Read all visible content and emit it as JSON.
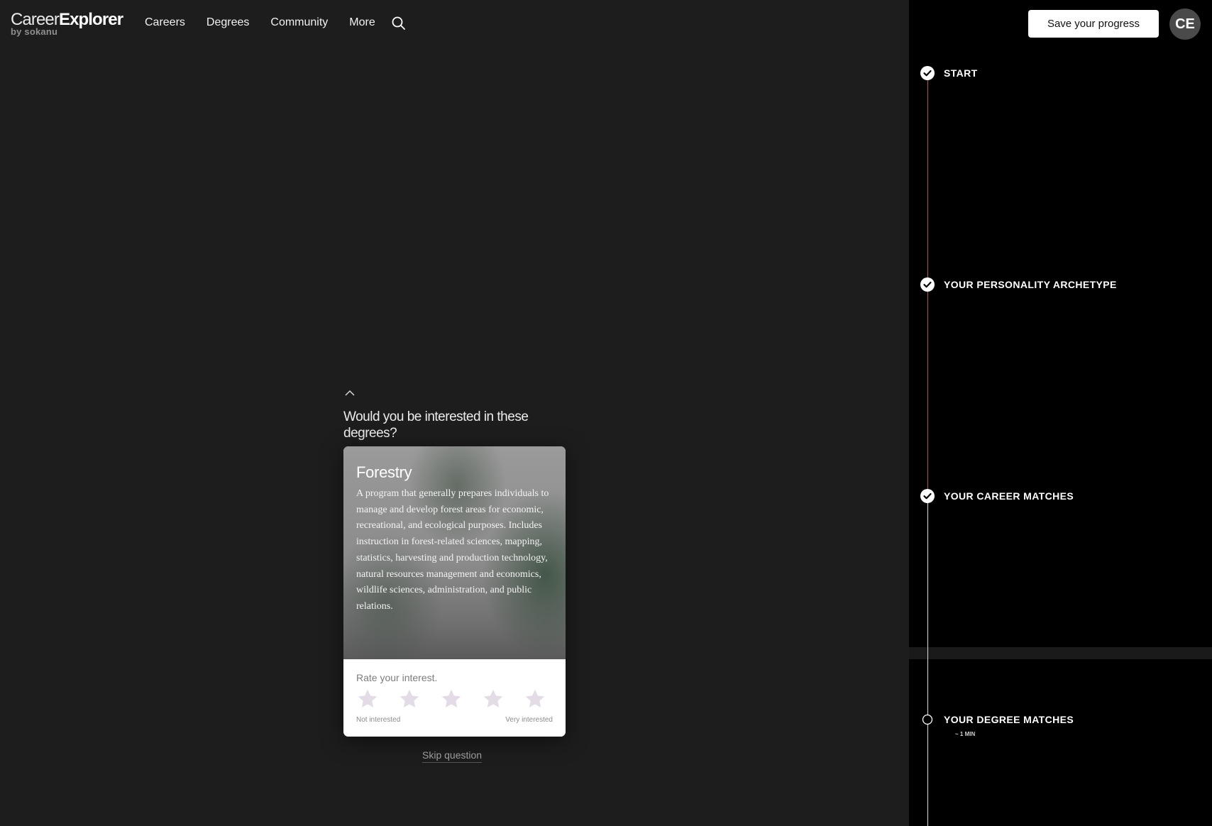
{
  "brand": {
    "name_light": "Career",
    "name_bold": "Explorer",
    "tagline": "by sokanu"
  },
  "nav": {
    "items": [
      {
        "label": "Careers"
      },
      {
        "label": "Degrees"
      },
      {
        "label": "Community"
      },
      {
        "label": "More"
      }
    ],
    "search_icon": "search-icon"
  },
  "question": {
    "text": "Would you be interested in these degrees?",
    "collapse_icon": "chevron-up-icon"
  },
  "card": {
    "title": "Forestry",
    "description": "A program that generally prepares individuals to manage and develop forest areas for economic, recreational, and ecological purposes. Includes instruction in forest-related sciences, mapping, statistics, harvesting and production technology, natural resources management and economics, wildlife sciences, administration, and public relations.",
    "rating_prompt": "Rate your interest.",
    "rating_value": 0,
    "rating_max": 5,
    "scale_low": "Not interested",
    "scale_high": "Very interested",
    "star_color": "#e3dbe6"
  },
  "skip_label": "Skip question",
  "panel": {
    "save_button": "Save your progress",
    "avatar_initials": "CE",
    "accent_color": "#c24a55",
    "steps": [
      {
        "label": "START",
        "status": "done"
      },
      {
        "label": "YOUR PERSONALITY ARCHETYPE",
        "status": "done"
      },
      {
        "label": "YOUR CAREER MATCHES",
        "status": "done"
      },
      {
        "label": "YOUR DEGREE MATCHES",
        "status": "current",
        "sub": "~ 1 MIN"
      }
    ]
  }
}
